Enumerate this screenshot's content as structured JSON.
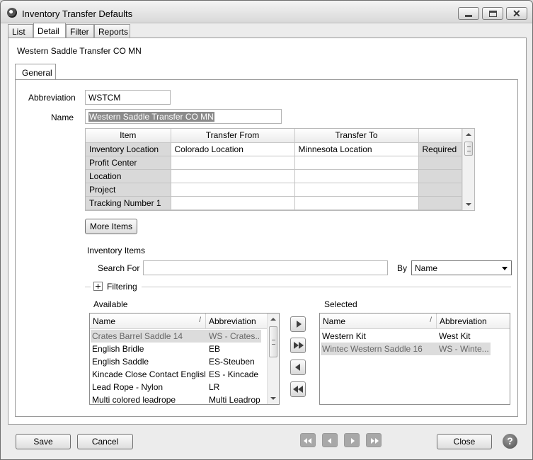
{
  "window": {
    "title": "Inventory Transfer Defaults"
  },
  "tabs": [
    {
      "label": "List"
    },
    {
      "label": "Detail"
    },
    {
      "label": "Filter"
    },
    {
      "label": "Reports"
    }
  ],
  "record_title": "Western Saddle Transfer CO MN",
  "subtab": "General",
  "form": {
    "abbreviation_label": "Abbreviation",
    "abbreviation_value": "WSTCM",
    "name_label": "Name",
    "name_value": "Western Saddle Transfer CO MN"
  },
  "grid": {
    "headers": [
      "Item",
      "Transfer From",
      "Transfer To",
      ""
    ],
    "rows": [
      {
        "item": "Inventory Location",
        "from": "Colorado Location",
        "to": "Minnesota Location",
        "req": "Required"
      },
      {
        "item": "Profit Center",
        "from": "",
        "to": "",
        "req": ""
      },
      {
        "item": "Location",
        "from": "",
        "to": "",
        "req": ""
      },
      {
        "item": "Project",
        "from": "",
        "to": "",
        "req": ""
      },
      {
        "item": "Tracking Number 1",
        "from": "",
        "to": "",
        "req": ""
      }
    ]
  },
  "more_items_label": "More Items",
  "inventory": {
    "section_label": "Inventory Items",
    "search_label": "Search For",
    "search_value": "",
    "by_label": "By",
    "by_value": "Name",
    "filtering_label": "Filtering",
    "available_label": "Available",
    "selected_label": "Selected",
    "col_name": "Name",
    "col_abbr": "Abbreviation",
    "available": [
      {
        "name": "Crates Barrel Saddle 14",
        "abbr": "WS - Crates..."
      },
      {
        "name": "English Bridle",
        "abbr": "EB"
      },
      {
        "name": "English Saddle",
        "abbr": "ES-Steuben"
      },
      {
        "name": "Kincade Close Contact English",
        "abbr": "ES - Kincade"
      },
      {
        "name": "Lead Rope - Nylon",
        "abbr": "LR"
      },
      {
        "name": "Multi colored leadrope",
        "abbr": "Multi Leadrope"
      }
    ],
    "selected": [
      {
        "name": "Western Kit",
        "abbr": "West Kit"
      },
      {
        "name": "Wintec Western Saddle 16",
        "abbr": "WS - Winte..."
      }
    ]
  },
  "footer": {
    "save_label": "Save",
    "cancel_label": "Cancel",
    "close_label": "Close",
    "help_glyph": "?"
  }
}
